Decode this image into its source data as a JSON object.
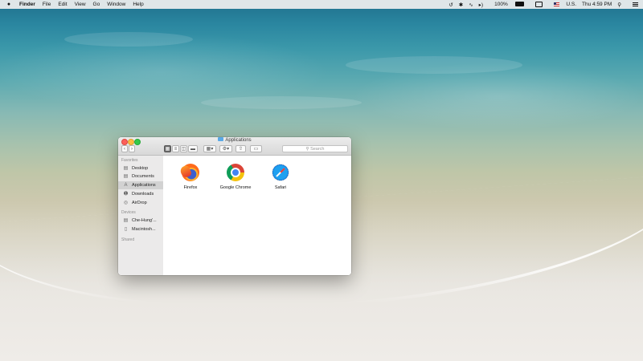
{
  "menubar": {
    "apple_icon": "apple-logo",
    "app_name": "Finder",
    "items": [
      "File",
      "Edit",
      "View",
      "Go",
      "Window",
      "Help"
    ],
    "status": {
      "battery_percent": "100%",
      "input_source": "U.S.",
      "clock": "Thu 4:59 PM"
    }
  },
  "window": {
    "title": "Applications",
    "search_placeholder": "Search",
    "view_modes": [
      "icon-view",
      "list-view",
      "column-view",
      "cover-flow-view"
    ],
    "active_view": "icon-view"
  },
  "sidebar": {
    "favorites_header": "Favorites",
    "favorites": [
      {
        "label": "Desktop",
        "icon": "desktop-icon"
      },
      {
        "label": "Documents",
        "icon": "documents-icon"
      },
      {
        "label": "Applications",
        "icon": "applications-icon",
        "selected": true
      },
      {
        "label": "Downloads",
        "icon": "downloads-icon"
      },
      {
        "label": "AirDrop",
        "icon": "airdrop-icon"
      }
    ],
    "devices_header": "Devices",
    "devices": [
      {
        "label": "Che-Hung'...",
        "icon": "laptop-icon"
      },
      {
        "label": "Macintosh...",
        "icon": "disk-icon"
      }
    ],
    "shared_header": "Shared"
  },
  "apps": [
    {
      "name": "Firefox",
      "icon": "firefox-icon"
    },
    {
      "name": "Google Chrome",
      "icon": "chrome-icon"
    },
    {
      "name": "Safari",
      "icon": "safari-icon"
    }
  ],
  "colors": {
    "close": "#fc605b",
    "minimize": "#fdbc40",
    "maximize": "#34c84a",
    "sidebar_selection": "#d2d2d2"
  }
}
